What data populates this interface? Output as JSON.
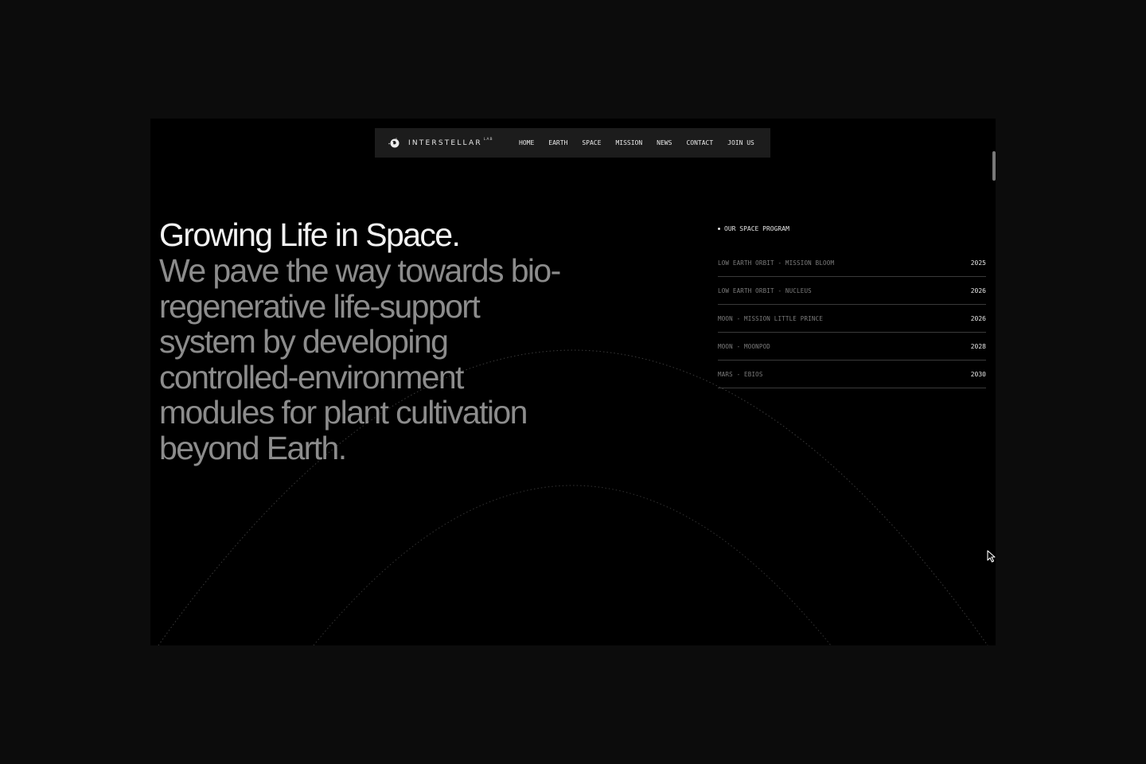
{
  "nav": {
    "logo_text": "INTERSTELLAR",
    "logo_sup": "LAB",
    "links": [
      {
        "label": "HOME"
      },
      {
        "label": "EARTH"
      },
      {
        "label": "SPACE"
      },
      {
        "label": "MISSION"
      },
      {
        "label": "NEWS"
      },
      {
        "label": "CONTACT"
      },
      {
        "label": "JOIN US"
      }
    ]
  },
  "hero": {
    "title": "Growing Life in Space.",
    "body": "We pave the way towards bio-regenerative life-support system by developing controlled-environment modules for plant cultivation beyond Earth."
  },
  "program": {
    "heading": "OUR SPACE PROGRAM",
    "items": [
      {
        "name": "LOW EARTH ORBIT - MISSION BLOOM",
        "year": "2025"
      },
      {
        "name": "LOW EARTH ORBIT - NUCLEUS",
        "year": "2026"
      },
      {
        "name": "MOON - MISSION LITTLE PRINCE",
        "year": "2026"
      },
      {
        "name": "MOON - MOONPOD",
        "year": "2028"
      },
      {
        "name": "MARS - EBIOS",
        "year": "2030"
      }
    ]
  },
  "colors": {
    "background": "#000000",
    "outer": "#0c0c0c",
    "nav_bg": "#1c1c1c",
    "title": "#f2f2f2",
    "body": "#8c8c8c"
  },
  "icons": {
    "logo": "planet-logo-icon",
    "cursor": "mouse-pointer-icon"
  }
}
